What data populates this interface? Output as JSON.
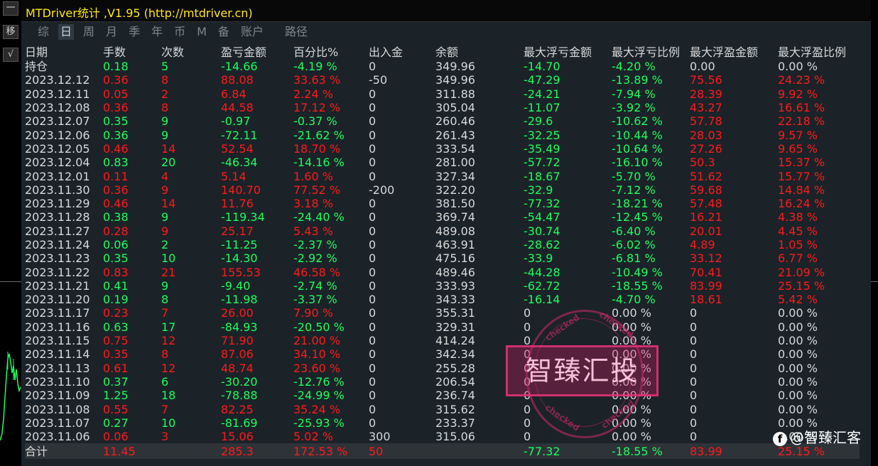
{
  "app": {
    "title": "MTDriver统计 ,V1.95 (http://mtdriver.cn)"
  },
  "side_buttons": [
    "一",
    "移",
    "√"
  ],
  "tabs": [
    {
      "label": "综"
    },
    {
      "label": "日",
      "active": true
    },
    {
      "label": "周"
    },
    {
      "label": "月"
    },
    {
      "label": "季"
    },
    {
      "label": "年"
    },
    {
      "label": "币"
    },
    {
      "label": "M"
    },
    {
      "label": "备"
    },
    {
      "label": "账户"
    },
    {
      "label": "路径"
    }
  ],
  "table": {
    "headers": [
      "日期",
      "手数",
      "次数",
      "盈亏金额",
      "百分比%",
      "出入金",
      "余额",
      "最大浮亏金额",
      "最大浮亏比例",
      "最大浮盈金额",
      "最大浮盈比例"
    ],
    "rows": [
      {
        "date": "持仓",
        "lots": "0.18",
        "count": "5",
        "pl": "-14.66",
        "pct": "-4.19 %",
        "io": "0",
        "bal": "349.96",
        "mfl": "-14.70",
        "mflp": "-4.20 %",
        "mfp": "0.00",
        "mfpp": "0.00 %",
        "s": "neg",
        "mfps": "neutral"
      },
      {
        "date": "2023.12.12",
        "lots": "0.36",
        "count": "8",
        "pl": "88.08",
        "pct": "33.63 %",
        "io": "-50",
        "bal": "349.96",
        "mfl": "-47.29",
        "mflp": "-13.89 %",
        "mfp": "75.56",
        "mfpp": "24.23 %",
        "s": "pos",
        "mfps": "pos"
      },
      {
        "date": "2023.12.11",
        "lots": "0.05",
        "count": "2",
        "pl": "6.84",
        "pct": "2.24 %",
        "io": "0",
        "bal": "311.88",
        "mfl": "-24.21",
        "mflp": "-7.94 %",
        "mfp": "28.39",
        "mfpp": "9.92 %",
        "s": "pos",
        "mfps": "pos"
      },
      {
        "date": "2023.12.08",
        "lots": "0.36",
        "count": "8",
        "pl": "44.58",
        "pct": "17.12 %",
        "io": "0",
        "bal": "305.04",
        "mfl": "-11.07",
        "mflp": "-3.92 %",
        "mfp": "43.27",
        "mfpp": "16.61 %",
        "s": "pos",
        "mfps": "pos"
      },
      {
        "date": "2023.12.07",
        "lots": "0.35",
        "count": "9",
        "pl": "-0.97",
        "pct": "-0.37 %",
        "io": "0",
        "bal": "260.46",
        "mfl": "-29.6",
        "mflp": "-10.62 %",
        "mfp": "57.78",
        "mfpp": "22.18 %",
        "s": "neg",
        "mfps": "pos"
      },
      {
        "date": "2023.12.06",
        "lots": "0.36",
        "count": "9",
        "pl": "-72.11",
        "pct": "-21.62 %",
        "io": "0",
        "bal": "261.43",
        "mfl": "-32.25",
        "mflp": "-10.44 %",
        "mfp": "28.03",
        "mfpp": "9.57 %",
        "s": "neg",
        "mfps": "pos"
      },
      {
        "date": "2023.12.05",
        "lots": "0.46",
        "count": "14",
        "pl": "52.54",
        "pct": "18.70 %",
        "io": "0",
        "bal": "333.54",
        "mfl": "-35.49",
        "mflp": "-10.64 %",
        "mfp": "27.26",
        "mfpp": "9.65 %",
        "s": "pos",
        "mfps": "pos"
      },
      {
        "date": "2023.12.04",
        "lots": "0.83",
        "count": "20",
        "pl": "-46.34",
        "pct": "-14.16 %",
        "io": "0",
        "bal": "281.00",
        "mfl": "-57.72",
        "mflp": "-16.10 %",
        "mfp": "50.3",
        "mfpp": "15.37 %",
        "s": "neg",
        "mfps": "pos"
      },
      {
        "date": "2023.12.01",
        "lots": "0.11",
        "count": "4",
        "pl": "5.14",
        "pct": "1.60 %",
        "io": "0",
        "bal": "327.34",
        "mfl": "-18.67",
        "mflp": "-5.70 %",
        "mfp": "51.62",
        "mfpp": "15.77 %",
        "s": "pos",
        "mfps": "pos"
      },
      {
        "date": "2023.11.30",
        "lots": "0.36",
        "count": "9",
        "pl": "140.70",
        "pct": "77.52 %",
        "io": "-200",
        "bal": "322.20",
        "mfl": "-32.9",
        "mflp": "-7.12 %",
        "mfp": "59.68",
        "mfpp": "14.84 %",
        "s": "pos",
        "mfps": "pos"
      },
      {
        "date": "2023.11.29",
        "lots": "0.46",
        "count": "14",
        "pl": "11.76",
        "pct": "3.18 %",
        "io": "0",
        "bal": "381.50",
        "mfl": "-77.32",
        "mflp": "-18.21 %",
        "mfp": "57.48",
        "mfpp": "16.24 %",
        "s": "pos",
        "mfps": "pos"
      },
      {
        "date": "2023.11.28",
        "lots": "0.38",
        "count": "9",
        "pl": "-119.34",
        "pct": "-24.40 %",
        "io": "0",
        "bal": "369.74",
        "mfl": "-54.47",
        "mflp": "-12.45 %",
        "mfp": "16.21",
        "mfpp": "4.38 %",
        "s": "neg",
        "mfps": "pos"
      },
      {
        "date": "2023.11.27",
        "lots": "0.28",
        "count": "9",
        "pl": "25.17",
        "pct": "5.43 %",
        "io": "0",
        "bal": "489.08",
        "mfl": "-30.74",
        "mflp": "-6.40 %",
        "mfp": "20.01",
        "mfpp": "4.45 %",
        "s": "pos",
        "mfps": "pos"
      },
      {
        "date": "2023.11.24",
        "lots": "0.06",
        "count": "2",
        "pl": "-11.25",
        "pct": "-2.37 %",
        "io": "0",
        "bal": "463.91",
        "mfl": "-28.62",
        "mflp": "-6.02 %",
        "mfp": "4.89",
        "mfpp": "1.05 %",
        "s": "neg",
        "mfps": "pos"
      },
      {
        "date": "2023.11.23",
        "lots": "0.35",
        "count": "10",
        "pl": "-14.30",
        "pct": "-2.92 %",
        "io": "0",
        "bal": "475.16",
        "mfl": "-33.9",
        "mflp": "-6.81 %",
        "mfp": "33.12",
        "mfpp": "6.77 %",
        "s": "neg",
        "mfps": "pos"
      },
      {
        "date": "2023.11.22",
        "lots": "0.83",
        "count": "21",
        "pl": "155.53",
        "pct": "46.58 %",
        "io": "0",
        "bal": "489.46",
        "mfl": "-44.28",
        "mflp": "-10.49 %",
        "mfp": "70.41",
        "mfpp": "21.09 %",
        "s": "pos",
        "mfps": "pos"
      },
      {
        "date": "2023.11.21",
        "lots": "0.41",
        "count": "9",
        "pl": "-9.40",
        "pct": "-2.74 %",
        "io": "0",
        "bal": "333.93",
        "mfl": "-62.72",
        "mflp": "-18.55 %",
        "mfp": "83.99",
        "mfpp": "25.15 %",
        "s": "neg",
        "mfps": "pos"
      },
      {
        "date": "2023.11.20",
        "lots": "0.19",
        "count": "8",
        "pl": "-11.98",
        "pct": "-3.37 %",
        "io": "0",
        "bal": "343.33",
        "mfl": "-16.14",
        "mflp": "-4.70 %",
        "mfp": "18.61",
        "mfpp": "5.42 %",
        "s": "neg",
        "mfps": "pos"
      },
      {
        "date": "2023.11.17",
        "lots": "0.23",
        "count": "7",
        "pl": "26.00",
        "pct": "7.90 %",
        "io": "0",
        "bal": "355.31",
        "mfl": "0",
        "mflp": "0.00 %",
        "mfp": "0",
        "mfpp": "0.00 %",
        "s": "pos",
        "mfps": "neutral"
      },
      {
        "date": "2023.11.16",
        "lots": "0.63",
        "count": "17",
        "pl": "-84.93",
        "pct": "-20.50 %",
        "io": "0",
        "bal": "329.31",
        "mfl": "0",
        "mflp": "0.00 %",
        "mfp": "0",
        "mfpp": "0.00 %",
        "s": "neg",
        "mfps": "neutral"
      },
      {
        "date": "2023.11.15",
        "lots": "0.75",
        "count": "12",
        "pl": "71.90",
        "pct": "21.00 %",
        "io": "0",
        "bal": "414.24",
        "mfl": "0",
        "mflp": "0.00 %",
        "mfp": "0",
        "mfpp": "0.00 %",
        "s": "pos",
        "mfps": "neutral"
      },
      {
        "date": "2023.11.14",
        "lots": "0.35",
        "count": "8",
        "pl": "87.06",
        "pct": "34.10 %",
        "io": "0",
        "bal": "342.34",
        "mfl": "0",
        "mflp": "0.00 %",
        "mfp": "0",
        "mfpp": "0.00 %",
        "s": "pos",
        "mfps": "neutral"
      },
      {
        "date": "2023.11.13",
        "lots": "0.61",
        "count": "12",
        "pl": "48.74",
        "pct": "23.60 %",
        "io": "0",
        "bal": "255.28",
        "mfl": "0",
        "mflp": "0.00 %",
        "mfp": "0",
        "mfpp": "0.00 %",
        "s": "pos",
        "mfps": "neutral"
      },
      {
        "date": "2023.11.10",
        "lots": "0.37",
        "count": "6",
        "pl": "-30.20",
        "pct": "-12.76 %",
        "io": "0",
        "bal": "206.54",
        "mfl": "0",
        "mflp": "0.00 %",
        "mfp": "0",
        "mfpp": "0.00 %",
        "s": "neg",
        "mfps": "neutral"
      },
      {
        "date": "2023.11.09",
        "lots": "1.25",
        "count": "18",
        "pl": "-78.88",
        "pct": "-24.99 %",
        "io": "0",
        "bal": "236.74",
        "mfl": "0",
        "mflp": "0.00 %",
        "mfp": "0",
        "mfpp": "0.00 %",
        "s": "neg",
        "mfps": "neutral"
      },
      {
        "date": "2023.11.08",
        "lots": "0.55",
        "count": "7",
        "pl": "82.25",
        "pct": "35.24 %",
        "io": "0",
        "bal": "315.62",
        "mfl": "0",
        "mflp": "0.00 %",
        "mfp": "0",
        "mfpp": "0.00 %",
        "s": "pos",
        "mfps": "neutral"
      },
      {
        "date": "2023.11.07",
        "lots": "0.27",
        "count": "10",
        "pl": "-81.69",
        "pct": "-25.93 %",
        "io": "0",
        "bal": "233.37",
        "mfl": "0",
        "mflp": "0.00 %",
        "mfp": "0",
        "mfpp": "0.00 %",
        "s": "neg",
        "mfps": "neutral"
      },
      {
        "date": "2023.11.06",
        "lots": "0.06",
        "count": "3",
        "pl": "15.06",
        "pct": "5.02 %",
        "io": "300",
        "bal": "315.06",
        "mfl": "0",
        "mflp": "0.00 %",
        "mfp": "0",
        "mfpp": "0.00 %",
        "s": "pos",
        "mfps": "neutral"
      }
    ],
    "total": {
      "date": "合计",
      "lots": "11.45",
      "count": "",
      "pl": "285.3",
      "pct": "172.53 %",
      "io": "50",
      "bal": "",
      "mfl": "-77.32",
      "mflp": "-18.55 %",
      "mfp": "83.99",
      "mfpp": "25.15 %"
    }
  },
  "stamp": {
    "text": "智臻汇投",
    "ring_text": "checked"
  },
  "watermark": {
    "text": "@智臻汇客"
  },
  "colors": {
    "positive": "#ff1a1a",
    "negative": "#19ff5e",
    "title": "#ffea00",
    "panel": "#1b2329"
  }
}
